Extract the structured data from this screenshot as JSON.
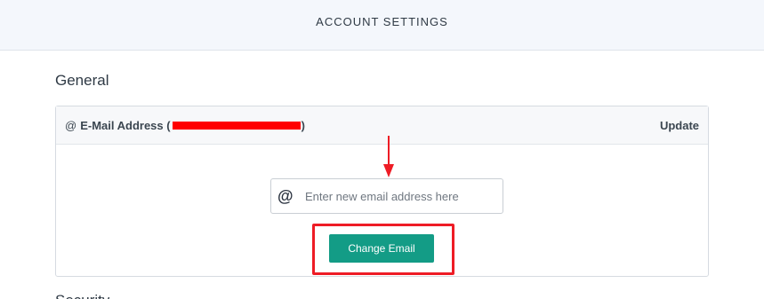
{
  "header": {
    "title": "ACCOUNT SETTINGS"
  },
  "general": {
    "heading": "General",
    "email_card": {
      "icon": "at-icon",
      "label_prefix": "E-Mail Address (",
      "label_suffix": ")",
      "update_label": "Update",
      "input_icon": "at-icon",
      "input_placeholder": "Enter new email address here",
      "input_value": "",
      "button_label": "Change Email"
    }
  },
  "annotation": {
    "color": "#ee1c25"
  },
  "next_section": {
    "heading": "Security"
  },
  "colors": {
    "accent": "#139c86",
    "header_bg": "#f4f7fc"
  }
}
